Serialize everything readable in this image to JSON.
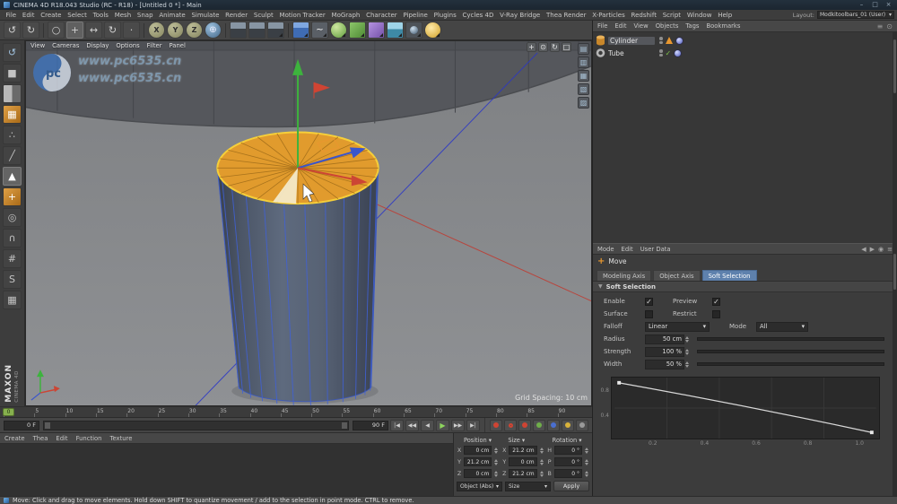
{
  "window": {
    "title": "CINEMA 4D R18.043 Studio (RC - R18) - [Untitled 0 *] - Main"
  },
  "menubar": {
    "items": [
      "File",
      "Edit",
      "Create",
      "Select",
      "Tools",
      "Mesh",
      "Snap",
      "Animate",
      "Simulate",
      "Render",
      "Sculpt",
      "Motion Tracker",
      "MoGraph",
      "Character",
      "Pipeline",
      "Plugins",
      "Cycles 4D",
      "V-Ray Bridge",
      "Thea Render",
      "X-Particles",
      "Redshift",
      "Script",
      "Window",
      "Help"
    ],
    "layout_label": "Layout:",
    "layout_value": "Modkitoolbars_01 (User)"
  },
  "icons": {
    "undo": "↺",
    "redo": "↻",
    "live_selection": "○",
    "move": "+",
    "scale": "↔",
    "rotate": "↻",
    "last_tool": "·",
    "axis_x": "X",
    "axis_y": "Y",
    "axis_z": "Z",
    "coord_system": "⊕",
    "pen": "~",
    "vp_pan": "+",
    "vp_zoom": "⊙",
    "vp_rotate": "↻",
    "vp_maximize": "□",
    "palette_1": "▤",
    "palette_2": "▥",
    "palette_3": "▦",
    "palette_4": "▧",
    "palette_5": "▨",
    "make_editable": "↺",
    "model_mode": "■",
    "points_mode": "∴",
    "edges_mode": "╱",
    "polygons_mode": "▲",
    "axis_mode": "+",
    "solo": "◎",
    "snap": "∩",
    "quantize": "#",
    "script_s": "S",
    "workplane": "▦",
    "dropdown": "▾",
    "collapse": "▼",
    "check": "✓",
    "tr_start": "|◀",
    "tr_prev_key": "◀◀",
    "tr_prev": "◀",
    "tr_play": "▶",
    "tr_next": "▶▶",
    "tr_end": "▶|",
    "back": "◀",
    "forward": "▶",
    "pin": "◉",
    "menu": "≡",
    "om_filter": "≡",
    "om_search": "⊙",
    "win_min": "–",
    "win_max": "□",
    "win_close": "×"
  },
  "viewport": {
    "menus": [
      "View",
      "Cameras",
      "Display",
      "Options",
      "Filter",
      "Panel"
    ],
    "grid_spacing": "Grid Spacing: 10 cm"
  },
  "watermark": {
    "logo_text": "pc",
    "line1": "www.pc6535.cn",
    "line2": "www.pc6535.cn"
  },
  "timeline": {
    "ticks": [
      "0",
      "5",
      "10",
      "15",
      "20",
      "25",
      "30",
      "35",
      "40",
      "45",
      "50",
      "55",
      "60",
      "65",
      "70",
      "75",
      "80",
      "85",
      "90"
    ],
    "current": "0"
  },
  "transport": {
    "start_field": "0 F",
    "end_field": "90 F"
  },
  "materials_panel": {
    "menus": [
      "Create",
      "Thea",
      "Edit",
      "Function",
      "Texture"
    ]
  },
  "coordinates": {
    "headers": [
      "Position",
      "Size",
      "Rotation"
    ],
    "position": [
      {
        "axis": "X",
        "value": "0 cm"
      },
      {
        "axis": "Y",
        "value": "21.2 cm"
      },
      {
        "axis": "Z",
        "value": "0 cm"
      }
    ],
    "size": [
      {
        "axis": "X",
        "value": "21.2 cm"
      },
      {
        "axis": "Y",
        "value": "0 cm"
      },
      {
        "axis": "Z",
        "value": "21.2 cm"
      }
    ],
    "rotation": [
      {
        "axis": "H",
        "value": "0 °"
      },
      {
        "axis": "P",
        "value": "0 °"
      },
      {
        "axis": "B",
        "value": "0 °"
      }
    ],
    "mode_dropdown": "Object (Abs)",
    "size_dropdown": "Size",
    "apply_label": "Apply"
  },
  "object_manager": {
    "menus": [
      "File",
      "Edit",
      "View",
      "Objects",
      "Tags",
      "Bookmarks"
    ],
    "objects": [
      {
        "name": "Cylinder"
      },
      {
        "name": "Tube"
      }
    ]
  },
  "attributes": {
    "header_menus": [
      "Mode",
      "Edit",
      "User Data"
    ],
    "tool_name": "Move",
    "tabs": [
      "Modeling Axis",
      "Object Axis",
      "Soft Selection"
    ],
    "section": "Soft Selection",
    "fields": {
      "enable_label": "Enable",
      "preview_label": "Preview",
      "surface_label": "Surface",
      "restrict_label": "Restrict",
      "falloff_label": "Falloff",
      "falloff_value": "Linear",
      "mode_label": "Mode",
      "mode_value": "All",
      "radius_label": "Radius",
      "radius_value": "50 cm",
      "strength_label": "Strength",
      "strength_value": "100 %",
      "width_label": "Width",
      "width_value": "50 %"
    }
  },
  "falloff_graph": {
    "y_ticks": [
      "0.8",
      "0.4"
    ],
    "x_ticks": [
      "0.2",
      "0.4",
      "0.6",
      "0.8",
      "1.0"
    ]
  },
  "chart_data": {
    "type": "line",
    "title": "Soft Selection Falloff (Linear)",
    "x": [
      0,
      0.2,
      0.4,
      0.6,
      0.8,
      1.0
    ],
    "y": [
      1.0,
      0.8,
      0.6,
      0.4,
      0.2,
      0.0
    ],
    "xlim": [
      0,
      1
    ],
    "ylim": [
      0,
      1
    ],
    "grid": true,
    "legend": false
  },
  "branding": {
    "maxon": "MAXON",
    "cinema": "CINEMA 4D"
  },
  "status": {
    "text": "Move: Click and drag to move elements. Hold down SHIFT to quantize movement / add to the selection in point mode. CTRL to remove."
  }
}
